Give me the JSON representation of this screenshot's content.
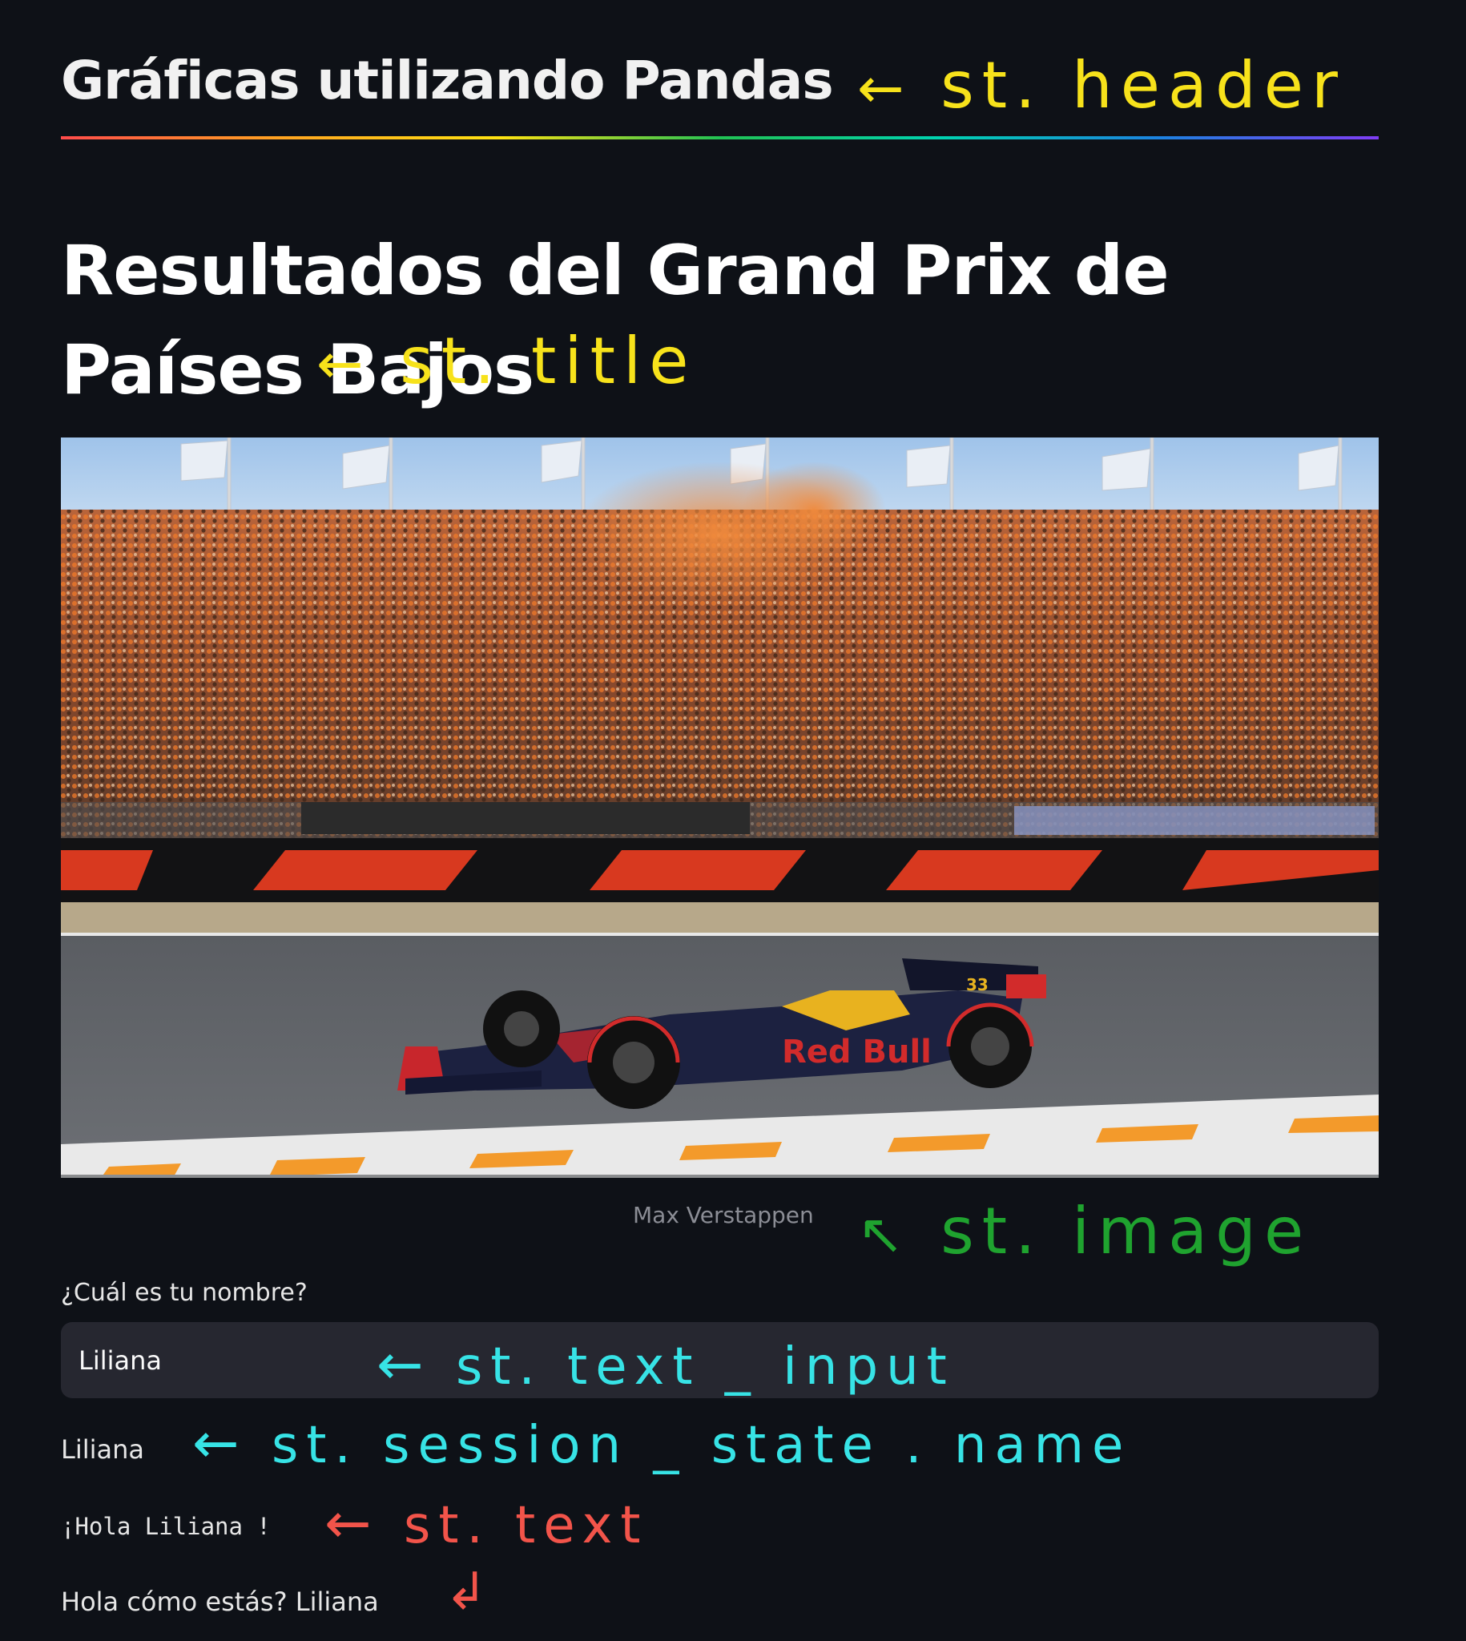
{
  "header": {
    "text": "Gráficas utilizando Pandas"
  },
  "title": {
    "text": "Resultados del Grand Prix de Países Bajos"
  },
  "image": {
    "caption": "Max Verstappen",
    "car_number": "33",
    "sponsor": "Red Bull"
  },
  "text_input": {
    "label": "¿Cuál es tu nombre?",
    "value": "Liliana"
  },
  "session_state": {
    "value": "Liliana"
  },
  "st_text": {
    "value": "¡Hola Liliana !"
  },
  "markdown_line": {
    "value": "Hola cómo estás? Liliana"
  },
  "annotations": {
    "header": "st. header",
    "title": "st. title",
    "image": "st. image",
    "text_input": "st. text _ input",
    "session_state": "st. session _ state . name",
    "text": "st. text",
    "colors": {
      "yellow": "#f7e21b",
      "green": "#1fa32f",
      "cyan": "#37e3e6",
      "red": "#f2544a"
    }
  }
}
